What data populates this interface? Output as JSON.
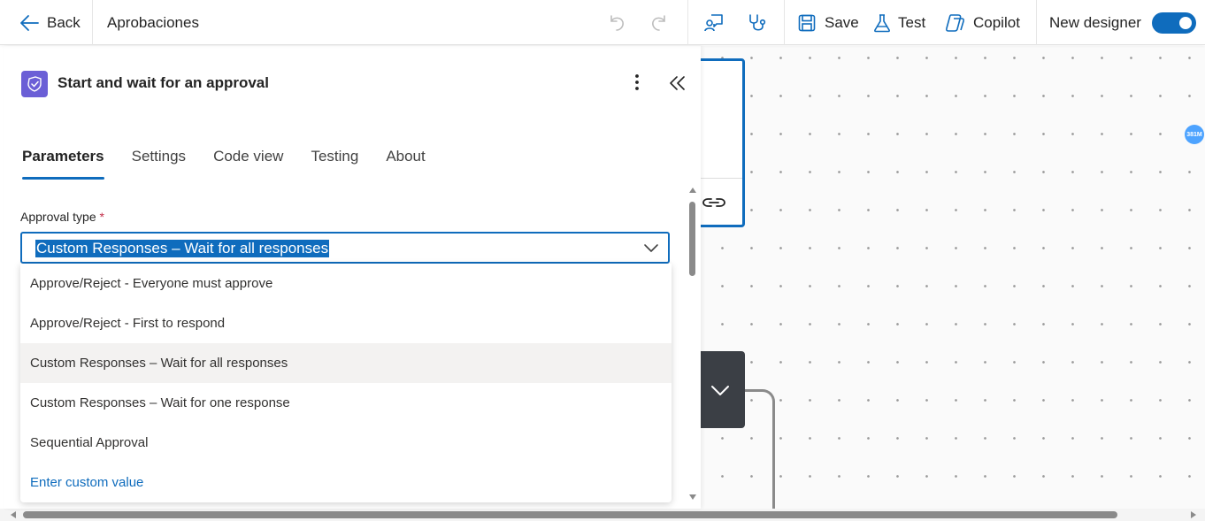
{
  "header": {
    "back_label": "Back",
    "flow_name": "Aprobaciones",
    "save_label": "Save",
    "test_label": "Test",
    "copilot_label": "Copilot",
    "new_designer_label": "New designer",
    "new_designer_on": true
  },
  "icons": {
    "back": "arrow-left-icon",
    "undo": "undo-icon",
    "redo": "redo-icon",
    "feedback": "feedback-icon",
    "checker": "stethoscope-icon",
    "save": "save-icon",
    "test": "flask-icon",
    "copilot": "copilot-icon",
    "action": "approval-icon",
    "more": "more-vertical-icon",
    "collapse": "double-chevron-left-icon",
    "link": "link-icon",
    "expand": "chevron-down-icon"
  },
  "panel": {
    "title": "Start and wait for an approval",
    "tabs": [
      {
        "label": "Parameters",
        "active": true
      },
      {
        "label": "Settings",
        "active": false
      },
      {
        "label": "Code view",
        "active": false
      },
      {
        "label": "Testing",
        "active": false
      },
      {
        "label": "About",
        "active": false
      }
    ],
    "approval_type": {
      "label": "Approval type",
      "required_mark": "*",
      "value": "Custom Responses – Wait for all responses",
      "options": [
        {
          "label": "Approve/Reject - Everyone must approve",
          "selected": false
        },
        {
          "label": "Approve/Reject - First to respond",
          "selected": false
        },
        {
          "label": "Custom Responses – Wait for all responses",
          "selected": true
        },
        {
          "label": "Custom Responses – Wait for one response",
          "selected": false
        },
        {
          "label": "Sequential Approval",
          "selected": false
        }
      ],
      "custom_value_label": "Enter custom value"
    }
  },
  "canvas": {
    "memory_badge": "381M"
  },
  "colors": {
    "accent": "#0f6cbd",
    "action_icon_bg": "#6b5fd6",
    "dark_node": "#3b3f45"
  }
}
